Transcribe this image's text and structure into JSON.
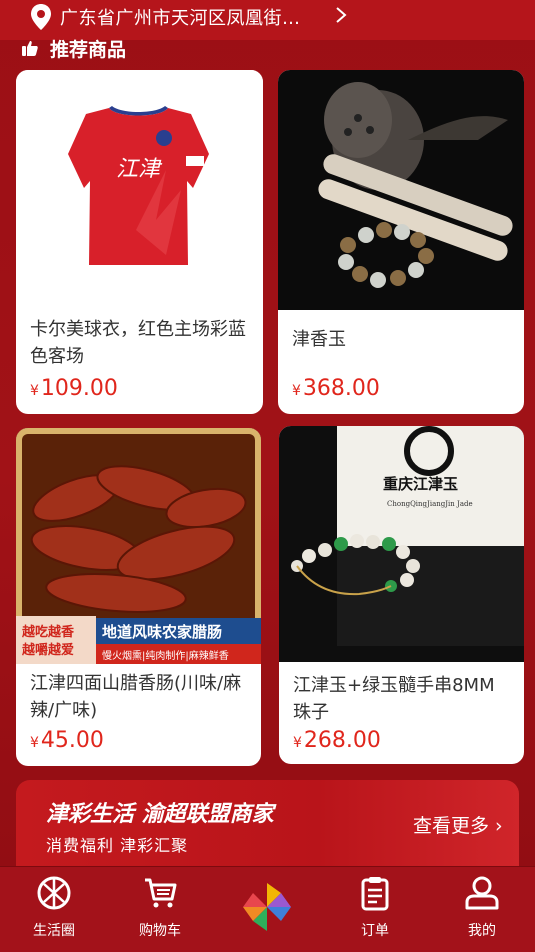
{
  "address": {
    "text": "广东省广州市天河区凤凰街…"
  },
  "section": {
    "title": "推荐商品"
  },
  "products": [
    {
      "name": "卡尔美球衣，红色主场彩蓝色客场",
      "currency": "¥",
      "price": "109.00",
      "jersey_text": "江津"
    },
    {
      "name": "津香玉",
      "currency": "¥",
      "price": "368.00"
    },
    {
      "name": "江津四面山腊香肠(川味/麻辣/广味)",
      "currency": "¥",
      "price": "45.00",
      "promo_left": "越吃越香\n越嚼越爱",
      "promo_title": "地道风味农家腊肠",
      "promo_sub": "慢火烟熏|纯肉制作|麻辣鲜香"
    },
    {
      "name": "江津玉+绿玉髓手串8MM珠子",
      "currency": "¥",
      "price": "268.00",
      "box_title": "重庆江津玉",
      "box_sub": "ChongQingJiangJin Jade"
    }
  ],
  "banner": {
    "title": "津彩生活 渝超联盟商家",
    "subtitle": "消费福利 津彩汇聚",
    "more": "查看更多"
  },
  "tabs": [
    {
      "label": "生活圈",
      "icon": "aperture-icon"
    },
    {
      "label": "购物车",
      "icon": "cart-icon"
    },
    {
      "label": "",
      "icon": "pinwheel-icon"
    },
    {
      "label": "订单",
      "icon": "clipboard-icon"
    },
    {
      "label": "我的",
      "icon": "user-icon"
    }
  ],
  "colors": {
    "accent": "#e0261c",
    "background": "#9c0f15",
    "tabbar": "#a3121a"
  }
}
